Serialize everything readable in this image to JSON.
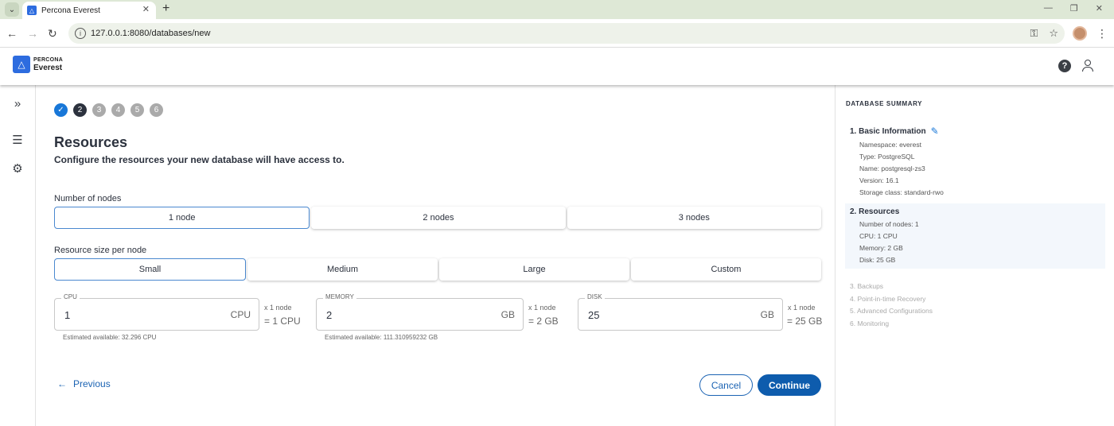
{
  "browser": {
    "tab_title": "Percona Everest",
    "url": "127.0.0.1:8080/databases/new"
  },
  "header": {
    "logo_top": "PERCONA",
    "logo_bottom": "Everest"
  },
  "stepper": {
    "steps": [
      "1",
      "2",
      "3",
      "4",
      "5",
      "6"
    ],
    "current": 2
  },
  "page": {
    "title": "Resources",
    "subtitle": "Configure the resources your new database will have access to."
  },
  "nodes": {
    "label": "Number of nodes",
    "options": [
      "1 node",
      "2 nodes",
      "3 nodes"
    ],
    "selected": "1 node"
  },
  "size": {
    "label": "Resource size per node",
    "options": [
      "Small",
      "Medium",
      "Large",
      "Custom"
    ],
    "selected": "Small"
  },
  "fields": {
    "cpu": {
      "label": "CPU",
      "value": "1",
      "unit": "CPU",
      "mult": "x 1 node",
      "total": "= 1 CPU",
      "help": "Estimated available: 32.296 CPU"
    },
    "memory": {
      "label": "MEMORY",
      "value": "2",
      "unit": "GB",
      "mult": "x 1 node",
      "total": "= 2 GB",
      "help": "Estimated available: 111.310959232 GB"
    },
    "disk": {
      "label": "DISK",
      "value": "25",
      "unit": "GB",
      "mult": "x 1 node",
      "total": "= 25 GB"
    }
  },
  "actions": {
    "previous": "Previous",
    "cancel": "Cancel",
    "continue": "Continue"
  },
  "summary": {
    "title": "DATABASE SUMMARY",
    "basic": {
      "heading": "1. Basic Information",
      "lines": [
        "Namespace: everest",
        "Type: PostgreSQL",
        "Name: postgresql-zs3",
        "Version: 16.1",
        "Storage class: standard-rwo"
      ]
    },
    "resources": {
      "heading": "2. Resources",
      "lines": [
        "Number of nodes: 1",
        "CPU: 1 CPU",
        "Memory: 2 GB",
        "Disk: 25 GB"
      ]
    },
    "pending": [
      "3. Backups",
      "4. Point-in-time Recovery",
      "5. Advanced Configurations",
      "6. Monitoring"
    ]
  },
  "colors": {
    "accent": "#1877d8",
    "primary_button": "#0e5cad",
    "active_step": "#2c323e"
  }
}
